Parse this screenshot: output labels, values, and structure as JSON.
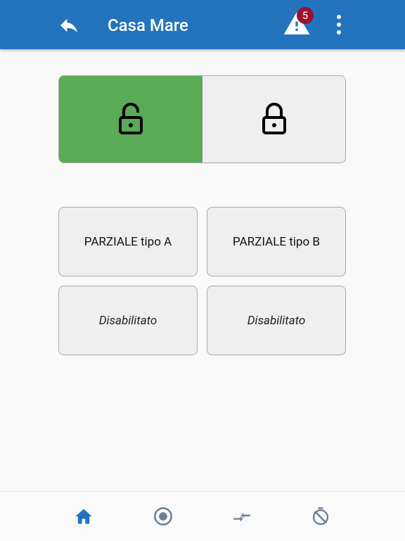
{
  "header": {
    "title": "Casa Mare",
    "alerts_count": "5",
    "back_icon": "reply-icon",
    "alert_icon": "warning-triangle-icon",
    "menu_icon": "more-vert-icon",
    "bar_color": "#2373bd",
    "badge_color": "#9e1030"
  },
  "arming": {
    "unlock_icon": "lock-open-icon",
    "lock_icon": "lock-closed-icon",
    "unlock_active_color": "#5aab55"
  },
  "partials": [
    {
      "label": "PARZIALE tipo A"
    },
    {
      "label": "PARZIALE tipo B"
    },
    {
      "label": "Disabilitato"
    },
    {
      "label": "Disabilitato"
    }
  ],
  "bottom_nav": [
    {
      "icon": "home-icon",
      "active": true
    },
    {
      "icon": "record-icon",
      "active": false
    },
    {
      "icon": "compress-arrows-icon",
      "active": false
    },
    {
      "icon": "timer-off-icon",
      "active": false
    }
  ]
}
